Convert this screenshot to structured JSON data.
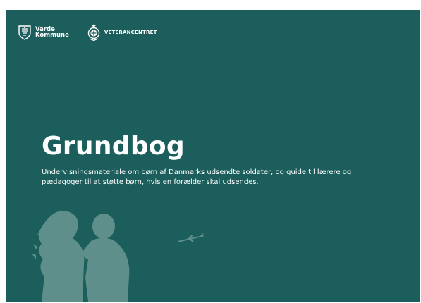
{
  "logos": {
    "municipality": {
      "line1": "Varde",
      "line2": "Kommune",
      "icon": "varde-crest-icon"
    },
    "veteran_center": {
      "label": "VETERANCENTRET",
      "icon": "veterancentret-emblem-icon"
    }
  },
  "cover": {
    "title": "Grundbog",
    "subtitle": "Undervisningsmateriale om børn af Danmarks udsendte soldater, og guide til lærere og pædagoger til at støtte børn, hvis en forælder skal udsendes."
  },
  "colors": {
    "background": "#1b5e5c",
    "silhouette": "#5f8f8b",
    "text": "#ffffff"
  },
  "illustrations": [
    "mother-and-child-silhouette",
    "airplane-icon"
  ]
}
